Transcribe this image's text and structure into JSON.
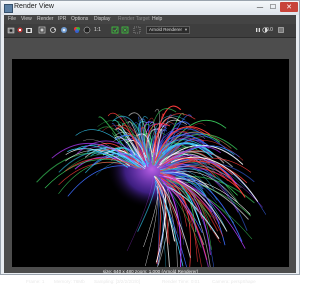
{
  "window": {
    "title": "Render View",
    "minimize_glyph": "—",
    "maximize_glyph": "☐",
    "close_glyph": "✕"
  },
  "menubar": {
    "items": [
      {
        "label": "File"
      },
      {
        "label": "View"
      },
      {
        "label": "Render"
      },
      {
        "label": "IPR"
      },
      {
        "label": "Options"
      },
      {
        "label": "Display"
      },
      {
        "label": "Render Target"
      },
      {
        "label": "Help"
      }
    ]
  },
  "toolbar": {
    "ratio_label": "1:1",
    "renderer": "Arnold Renderer",
    "exposure_value": "0.0",
    "icons": [
      "render-icon",
      "redo-icon",
      "snapshot-icon",
      "ipr-icon",
      "refresh-icon",
      "rgb-channel-icon",
      "display-icon",
      "keep-image-icon",
      "remove-image-icon",
      "region-icon",
      "pause-icon",
      "exposure-icon"
    ]
  },
  "colors": {
    "maya_bg": "#444444",
    "render_bg": "#000000",
    "strand_colors": [
      "#ff3b3b",
      "#3b6bff",
      "#3bd25f",
      "#b43bff",
      "#ffffff",
      "#38d5ff"
    ]
  },
  "status": {
    "line1": "size: 640 x 480  zoom: 1.000    (Arnold Renderer)",
    "frame": "Frame: 1",
    "memory": "Memory: 76Mb",
    "sampling": "Sampling: [3/2/2/2/2/0]",
    "render_time": "Render Time: 0:01",
    "camera": "Camera: perspShape"
  }
}
